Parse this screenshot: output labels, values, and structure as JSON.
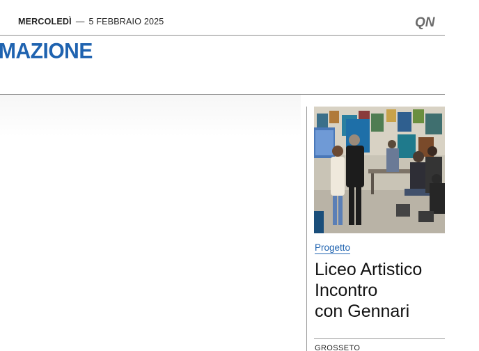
{
  "header": {
    "day": "MERCOLEDÌ",
    "separator": "—",
    "date": "5 FEBBRAIO 2025",
    "logo_text": "QN"
  },
  "section": {
    "title": "MAZIONE"
  },
  "sidebar_article": {
    "photo_icon": "classroom-photo",
    "kicker": "Progetto",
    "headline_lines": [
      "Liceo Artistico",
      "Incontro",
      "con Gennari"
    ],
    "place": "GROSSETO"
  },
  "colors": {
    "accent": "#1f63b0",
    "rule": "#8a8a8a",
    "text": "#111111"
  }
}
